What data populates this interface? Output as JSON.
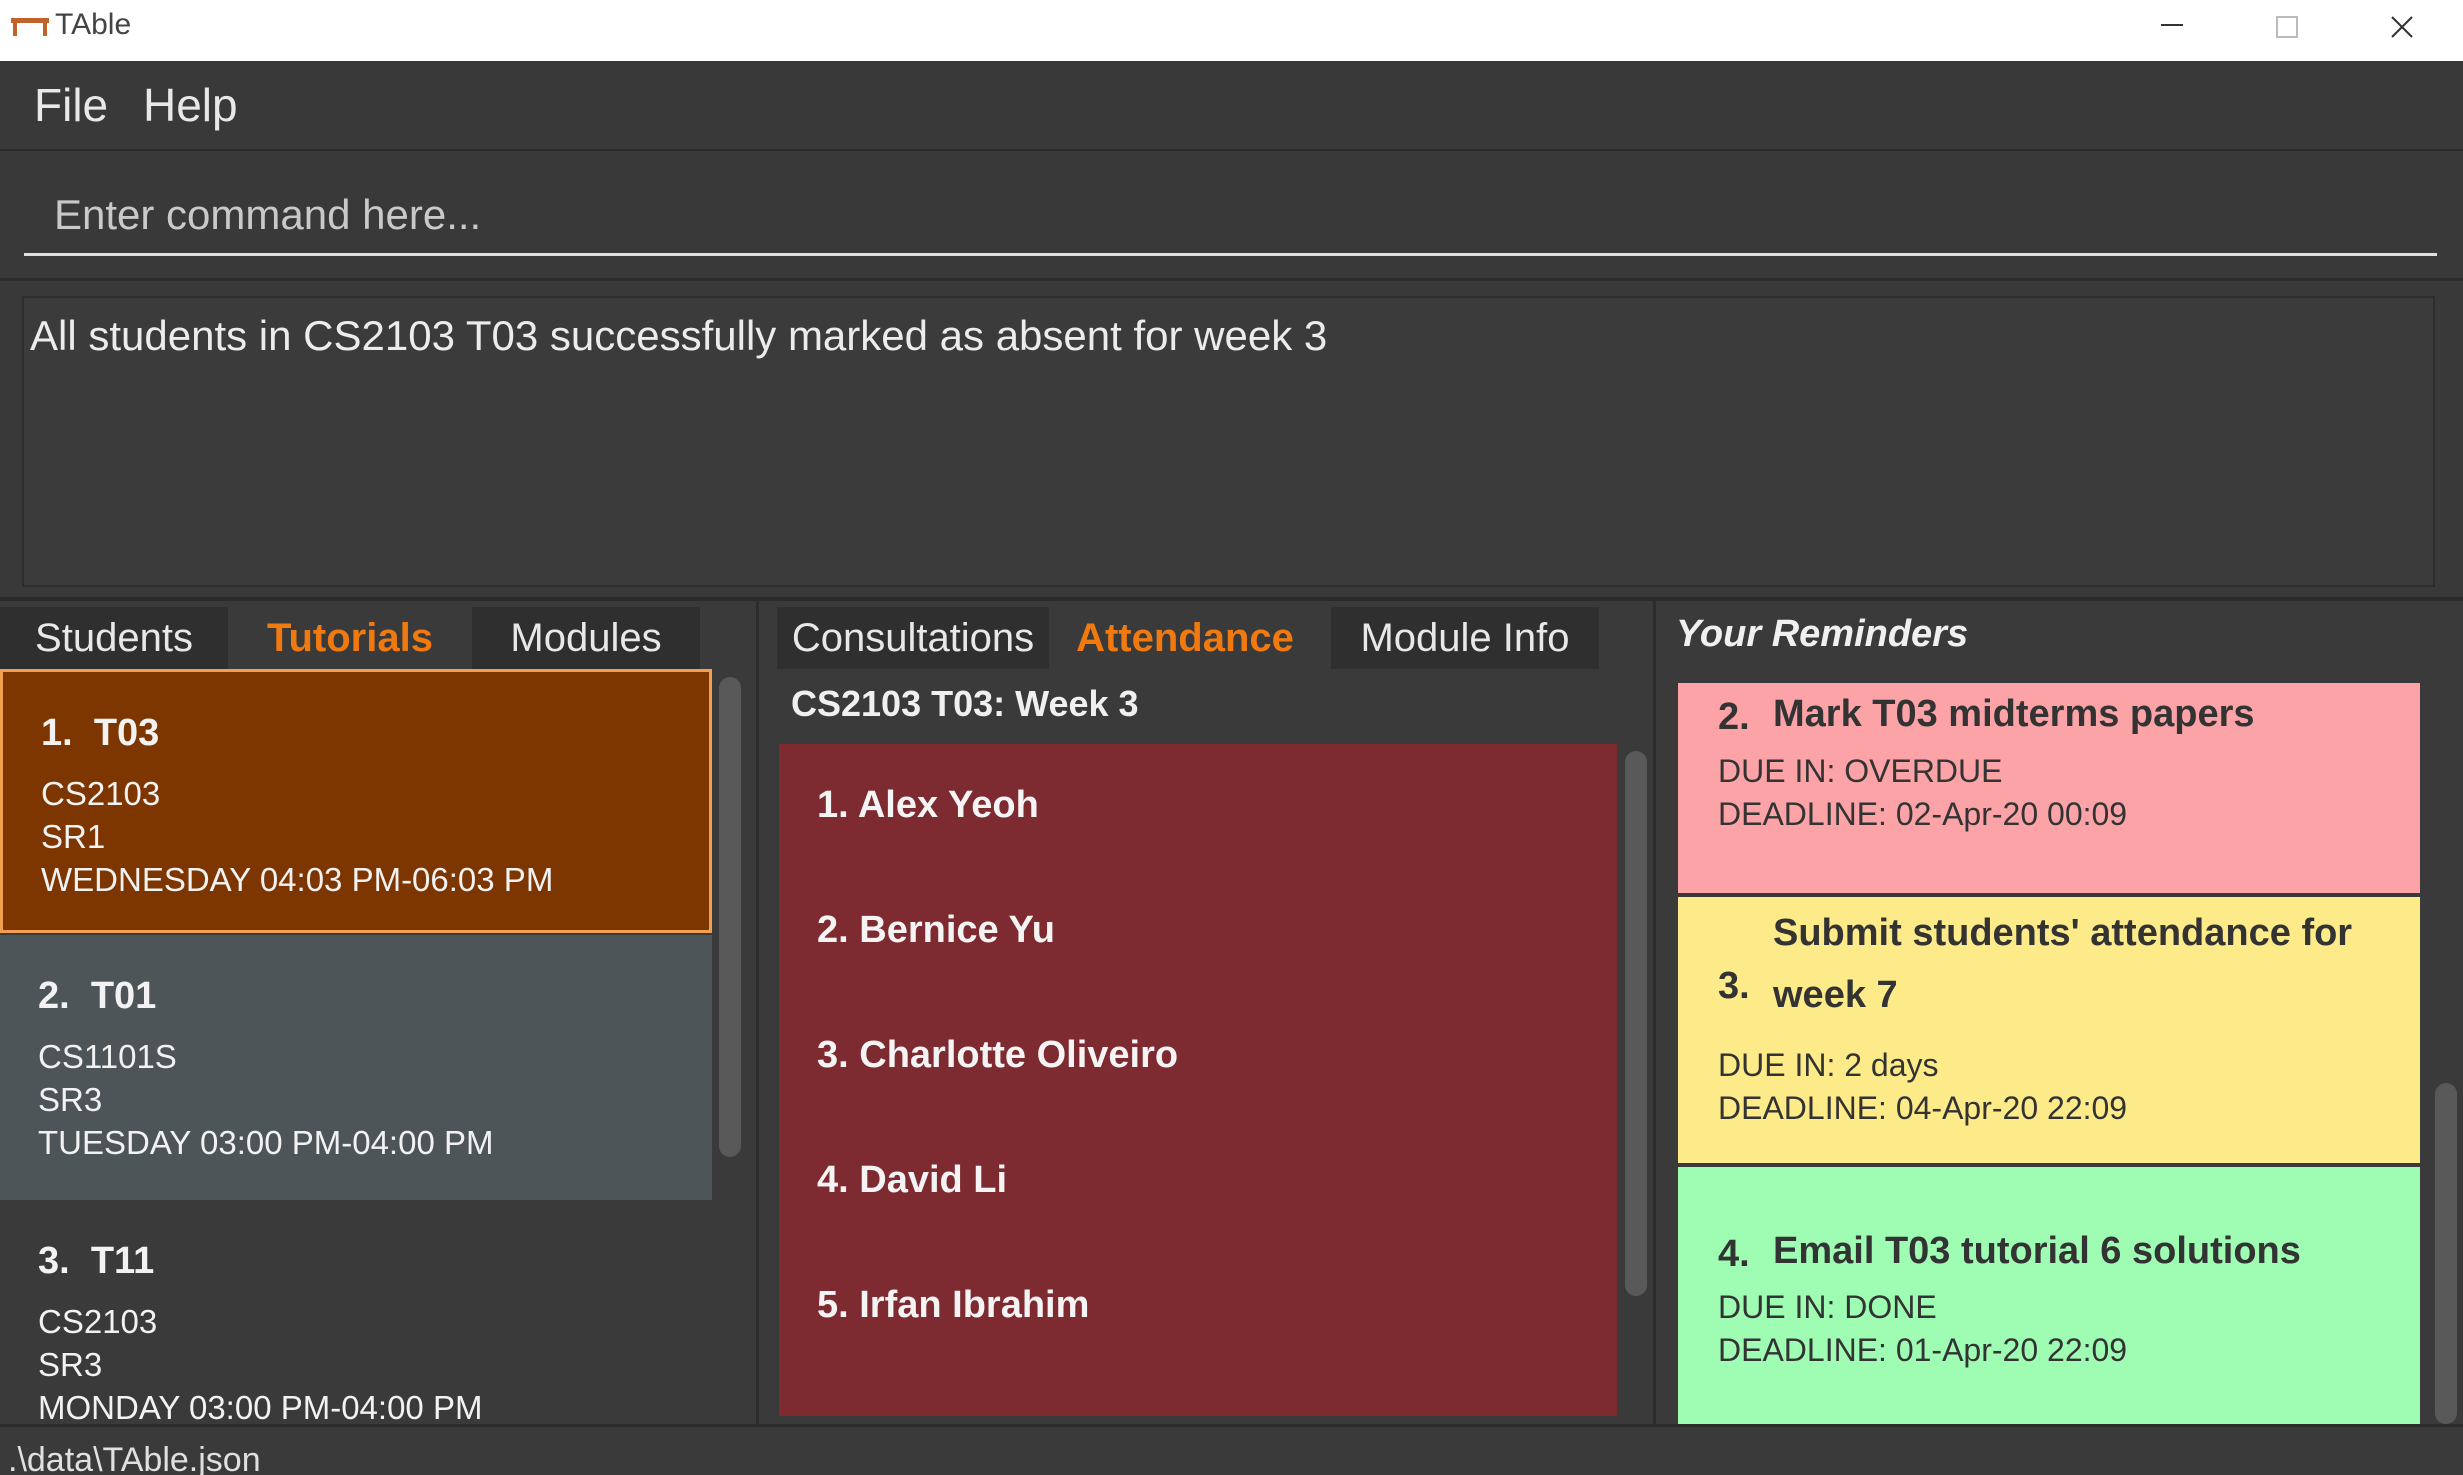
{
  "window": {
    "title": "TAble"
  },
  "menu": {
    "items": [
      "File",
      "Help"
    ]
  },
  "command": {
    "placeholder": "Enter command here..."
  },
  "result": {
    "message": "All students in CS2103 T03 successfully marked as absent for week 3"
  },
  "left_tabs": [
    "Students",
    "Tutorials",
    "Modules"
  ],
  "left_active_tab": "Tutorials",
  "tutorials": [
    {
      "index": "1.",
      "name": "T03",
      "module": "CS2103",
      "venue": "SR1",
      "time": "WEDNESDAY 04:03 PM-06:03 PM",
      "color": "#7d3600",
      "selected": true
    },
    {
      "index": "2.",
      "name": "T01",
      "module": "CS1101S",
      "venue": "SR3",
      "time": "TUESDAY 03:00 PM-04:00 PM",
      "color": "#4e5559",
      "selected": false
    },
    {
      "index": "3.",
      "name": "T11",
      "module": "CS2103",
      "venue": "SR3",
      "time": "MONDAY 03:00 PM-04:00 PM",
      "color": "#3a3a3b",
      "selected": false
    }
  ],
  "mid_tabs": [
    "Consultations",
    "Attendance",
    "Module Info"
  ],
  "mid_active_tab": "Attendance",
  "attendance": {
    "header": "CS2103 T03: Week 3",
    "students": [
      "1.  Alex Yeoh",
      "2.  Bernice Yu",
      "3.  Charlotte Oliveiro",
      "4.  David Li",
      "5.  Irfan Ibrahim"
    ],
    "list_color": "#7d2a30"
  },
  "reminders": {
    "title": "Your Reminders",
    "items": [
      {
        "index": "2.",
        "title_lines": [
          "Mark T03 midterms papers"
        ],
        "due": "DUE IN: OVERDUE",
        "deadline": "DEADLINE: 02-Apr-20 00:09",
        "color": "#fba3a7"
      },
      {
        "index": "3.",
        "title_lines": [
          "Submit students' attendance for",
          "week 7"
        ],
        "due": "DUE IN: 2 days",
        "deadline": "DEADLINE: 04-Apr-20 22:09",
        "color": "#fdea88"
      },
      {
        "index": "4.",
        "title_lines": [
          "Email T03 tutorial 6 solutions"
        ],
        "due": "DUE IN: DONE",
        "deadline": "DEADLINE: 01-Apr-20 22:09",
        "color": "#9efcb3"
      }
    ]
  },
  "status": {
    "path": ".\\data\\TAble.json"
  }
}
